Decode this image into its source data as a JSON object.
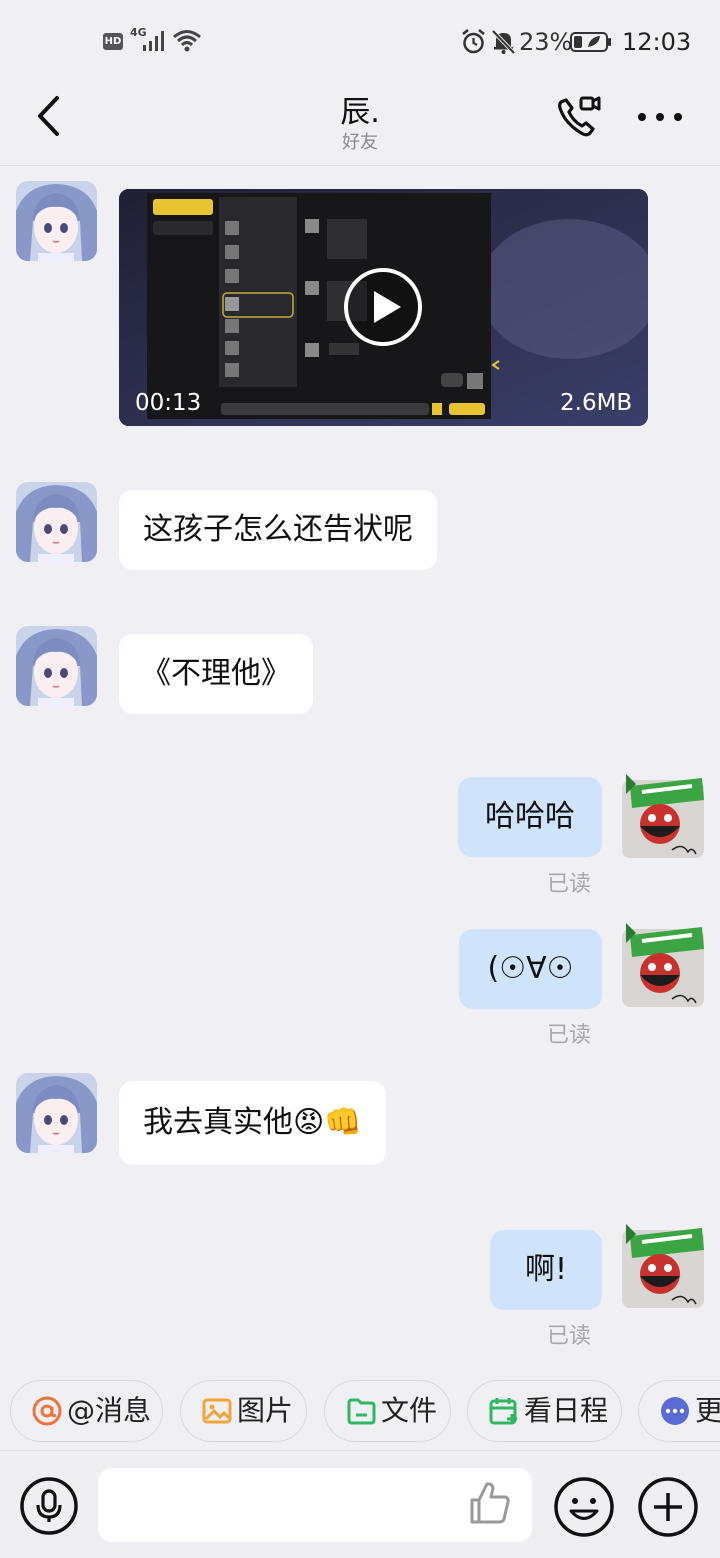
{
  "status_bar": {
    "hd": "HD",
    "network": "4G",
    "battery": "23%",
    "time": "12:03"
  },
  "header": {
    "title": "辰.",
    "subtitle": "好友"
  },
  "video_message": {
    "duration": "00:13",
    "size": "2.6MB"
  },
  "messages": [
    {
      "side": "in",
      "text": "这孩子怎么还告状呢"
    },
    {
      "side": "in",
      "text": "《不理他》"
    },
    {
      "side": "out",
      "text": "哈哈哈",
      "status": "已读"
    },
    {
      "side": "out",
      "text": "(☉∀☉",
      "status": "已读"
    },
    {
      "side": "in",
      "text": "我去真实他",
      "emoji": [
        "😡",
        "👊"
      ]
    },
    {
      "side": "out",
      "text": "啊!",
      "status": "已读"
    }
  ],
  "quick_actions": [
    {
      "label": "@消息",
      "icon": "at-icon"
    },
    {
      "label": "图片",
      "icon": "image-icon"
    },
    {
      "label": "文件",
      "icon": "folder-icon"
    },
    {
      "label": "看日程",
      "icon": "calendar-icon"
    },
    {
      "label": "更",
      "icon": "more-dots-icon"
    }
  ],
  "colors": {
    "background": "#f0eff4",
    "outgoing_bubble": "#cfe4fb",
    "incoming_bubble": "#ffffff",
    "at_icon": "#f0743a",
    "image_icon": "#f2a63a",
    "folder_icon": "#2fb864",
    "calendar_icon": "#2fb864",
    "more_icon": "#5b6bd6"
  }
}
